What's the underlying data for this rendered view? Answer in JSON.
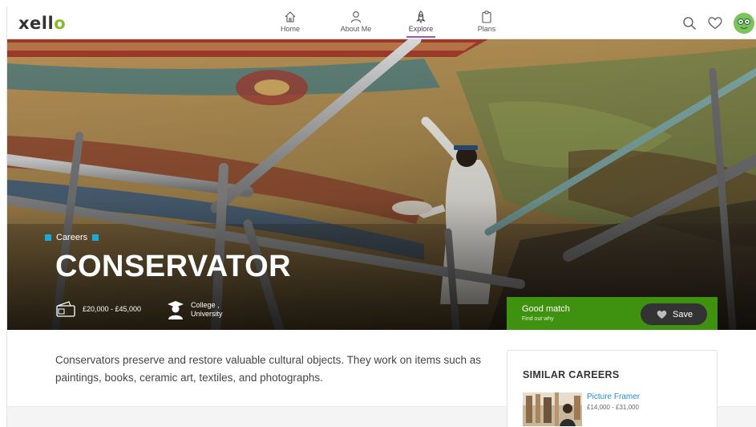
{
  "app": {
    "logo_text": "xell",
    "logo_accent": "o",
    "accent_color": "#8ab92d"
  },
  "nav": {
    "items": [
      {
        "label": "Home",
        "icon": "home-icon"
      },
      {
        "label": "About Me",
        "icon": "person-icon"
      },
      {
        "label": "Explore",
        "icon": "rocket-icon",
        "active": true
      },
      {
        "label": "Plans",
        "icon": "clipboard-icon"
      }
    ],
    "active_color": "#9b59b6"
  },
  "header_icons": [
    "search-icon",
    "heart-icon",
    "avatar"
  ],
  "hero": {
    "breadcrumb": "Careers",
    "title": "CONSERVATOR",
    "salary": "£20,000 - £45,000",
    "education_line1": "College ,",
    "education_line2": "University"
  },
  "match": {
    "title": "Good match",
    "subtitle": "Find out why",
    "save_label": "Save",
    "color": "#3f9210"
  },
  "description": "Conservators preserve and restore valuable cultural objects. They work on items such as paintings, books, ceramic art, textiles, and photographs.",
  "similar": {
    "heading": "SIMILAR CAREERS",
    "items": [
      {
        "name": "Picture Framer",
        "salary": "£14,000 - £31,000"
      }
    ]
  }
}
